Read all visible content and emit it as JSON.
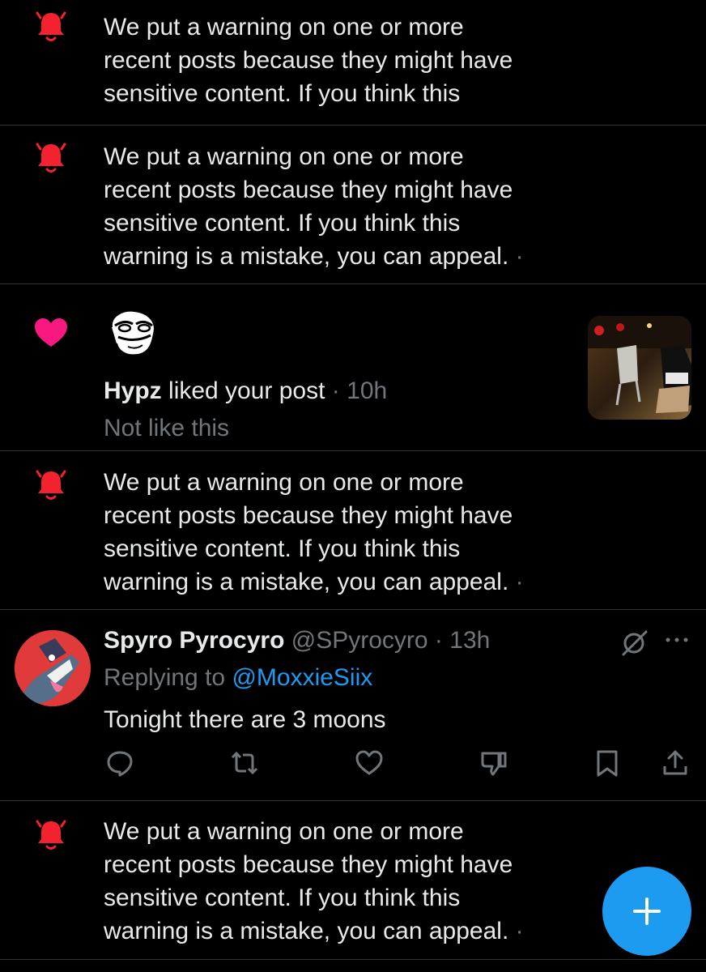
{
  "warning_notices": [
    {
      "text": "We put a warning on one or more\nrecent posts because they might have\nsensitive content. If you think this",
      "dot": ""
    },
    {
      "text": "We put a warning on one or more\nrecent posts because they might have\nsensitive content. If you think this\nwarning is a mistake, you can appeal. ",
      "dot": "·"
    },
    {
      "text": "We put a warning on one or more\nrecent posts because they might have\nsensitive content. If you think this\nwarning is a mistake, you can appeal. ",
      "dot": "·"
    },
    {
      "text": "We put a warning on one or more\nrecent posts because they might have\nsensitive content. If you think this\nwarning is a mistake, you can appeal. ",
      "dot": "·"
    }
  ],
  "like_notification": {
    "user_name": "Hypz",
    "action_text": " liked your post",
    "separator": " · ",
    "time": "10h",
    "secondary_action": "Not like this"
  },
  "reply": {
    "display_name": "Spyro Pyrocyro",
    "handle": " @SPyrocyro",
    "separator": " · ",
    "time": "13h",
    "replying_prefix": "Replying to ",
    "replying_to": "@MoxxieSiix",
    "body": "Tonight there are 3 moons",
    "actions": [
      "reply-icon",
      "retweet-icon",
      "like-icon",
      "downvote-icon",
      "bookmark-icon",
      "share-icon"
    ]
  },
  "colors": {
    "background": "#000000",
    "text": "#e7e9ea",
    "muted": "#71767b",
    "accent": "#1d9bf0",
    "warning_red": "#f4212e",
    "like_pink": "#f91880",
    "divider": "#2f3336"
  },
  "fab": {
    "icon": "plus-icon"
  }
}
